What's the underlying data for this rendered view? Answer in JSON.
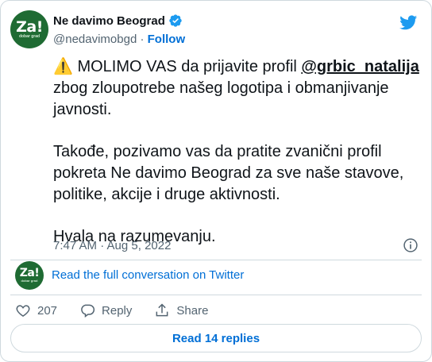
{
  "account": {
    "display_name": "Ne davimo Beograd",
    "handle": "@nedavimobgd",
    "separator": " · ",
    "follow_label": "Follow",
    "avatar_text": "Za!",
    "avatar_subtext": "dobar grad"
  },
  "tweet": {
    "warning_emoji": "⚠️",
    "line1_prefix": " MOLIMO VAS da prijavite profil ",
    "mention": "@grbic_natalija",
    "line1_suffix": "zbog zloupotrebe našeg logotipa i obmanjivanje javnosti.",
    "paragraph2": "Takođe, pozivamo vas da pratite zvanični profil pokreta Ne davimo Beograd za sve naše stavove, politike, akcije i druge aktivnosti.",
    "paragraph3": "Hvala na razumevanju.",
    "timestamp": "7:47 AM · Aug 5, 2022"
  },
  "conversation": {
    "link_label": "Read the full conversation on Twitter"
  },
  "actions": {
    "like_count": "207",
    "reply_label": "Reply",
    "share_label": "Share"
  },
  "replies": {
    "button_label": "Read 14 replies"
  },
  "colors": {
    "link_blue": "#006fd6",
    "twitter_blue": "#1d9bf0",
    "avatar_green": "#1f6b33",
    "muted_text": "#536471"
  },
  "icons": [
    "verified-badge-icon",
    "twitter-bird-icon",
    "info-icon",
    "heart-icon",
    "reply-icon",
    "share-icon"
  ]
}
